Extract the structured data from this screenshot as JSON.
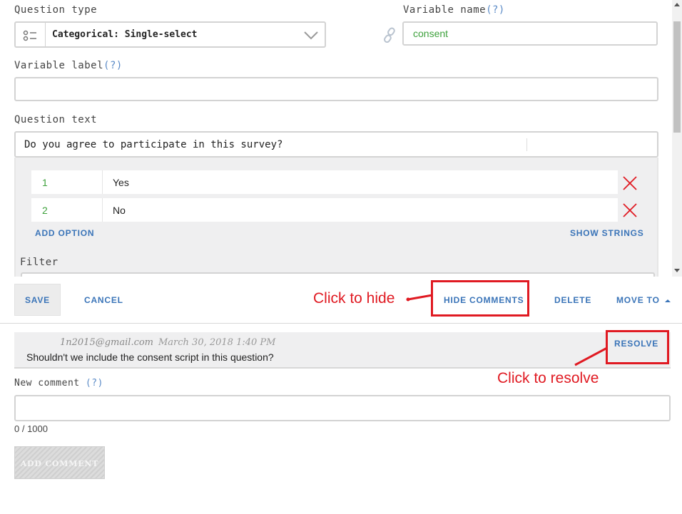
{
  "question_type": {
    "label": "Question type",
    "value": "Categorical: Single-select"
  },
  "variable_name": {
    "label": "Variable name",
    "help": "(?)",
    "value": "consent"
  },
  "variable_label": {
    "label": "Variable label",
    "help": "(?)",
    "value": ""
  },
  "question_text": {
    "label": "Question text",
    "value": "Do you agree to participate in this survey?"
  },
  "options": [
    {
      "code": "1",
      "text": "Yes"
    },
    {
      "code": "2",
      "text": "No"
    }
  ],
  "option_actions": {
    "add": "ADD OPTION",
    "show_strings": "SHOW STRINGS"
  },
  "filter": {
    "label": "Filter"
  },
  "toolbar": {
    "save": "SAVE",
    "cancel": "CANCEL",
    "hide_comments": "HIDE COMMENTS",
    "delete": "DELETE",
    "move_to": "MOVE TO"
  },
  "comment": {
    "author": "1n2015@gmail.com",
    "date": "March 30, 2018 1:40 PM",
    "text": "Shouldn't we include the consent script in this question?",
    "resolve": "RESOLVE"
  },
  "new_comment": {
    "label": "New comment",
    "help": "(?)",
    "value": "",
    "counter": "0 / 1000",
    "add_button": "ADD COMMENT"
  },
  "annotations": {
    "hide": "Click to hide",
    "resolve": "Click to resolve"
  },
  "colors": {
    "accent_blue": "#3a74b8",
    "green_value": "#3ea13c",
    "annotation_red": "#e01a22",
    "panel_grey": "#efeff0"
  }
}
